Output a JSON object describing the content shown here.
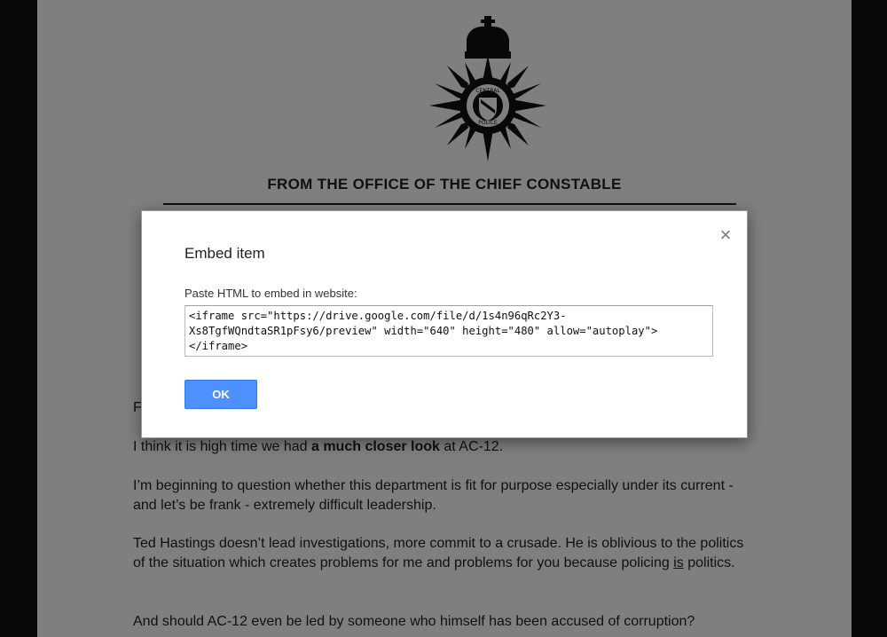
{
  "document": {
    "crest_top_text": "CENTRAL",
    "crest_bottom_text": "POLICE",
    "letterhead": "FROM THE OFFICE OF THE CHIEF CONSTABLE",
    "greeting_partial": "F",
    "para1_start": "I think it is high time we had ",
    "para1_bold": "a much closer look",
    "para1_end": " at AC-12.",
    "para2": "I’m beginning to question whether this department is fit for purpose especially under its current - and let’s be frank - extremely difficult leadership.",
    "para3_start": "Ted Hastings doesn’t lead investigations, more commit to a crusade. He is oblivious to the politics of the situation which creates problems for me and problems for you because policing ",
    "para3_underline": "is",
    "para3_end": " politics.",
    "para4": "And should AC-12 even be led by someone who himself has been accused of corruption?"
  },
  "dialog": {
    "title": "Embed item",
    "close_glyph": "×",
    "label": "Paste HTML to embed in website:",
    "embed_code": "<iframe src=\"https://drive.google.com/file/d/1s4n96qRc2Y3-Xs8TgfWQndtaSR1pFsy6/preview\" width=\"640\" height=\"480\" allow=\"autoplay\"></iframe>",
    "ok_label": "OK"
  },
  "icons": {
    "close": "close-icon",
    "crest": "police-crest-icon"
  },
  "colors": {
    "ok_button": "#4d90fe",
    "overlay": "rgba(0,0,0,0.5)"
  }
}
